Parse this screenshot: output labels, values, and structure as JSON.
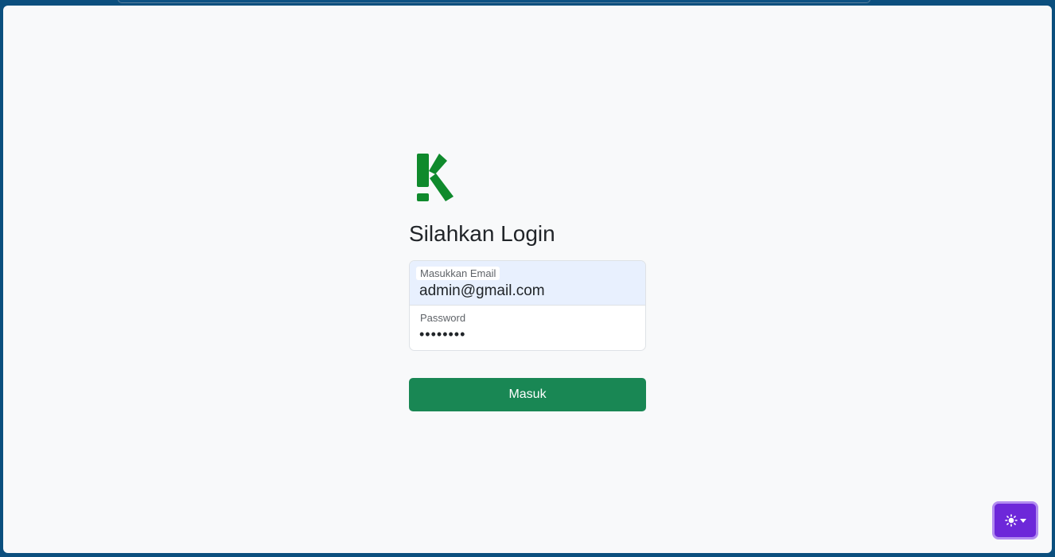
{
  "brand": {
    "logo_icon": "k-logo-icon",
    "logo_color": "#0f8a2c"
  },
  "login": {
    "title": "Silahkan Login",
    "email": {
      "label": "Masukkan Email",
      "value": "admin@gmail.com"
    },
    "password": {
      "label": "Password",
      "value": "••••••••"
    },
    "submit_label": "Masuk"
  },
  "theme_toggle": {
    "icon": "sun-icon",
    "dropdown_icon": "caret-down-icon"
  },
  "colors": {
    "primary_button": "#198754",
    "theme_button": "#6d28d9",
    "email_autofill_bg": "#e8f0fe"
  }
}
